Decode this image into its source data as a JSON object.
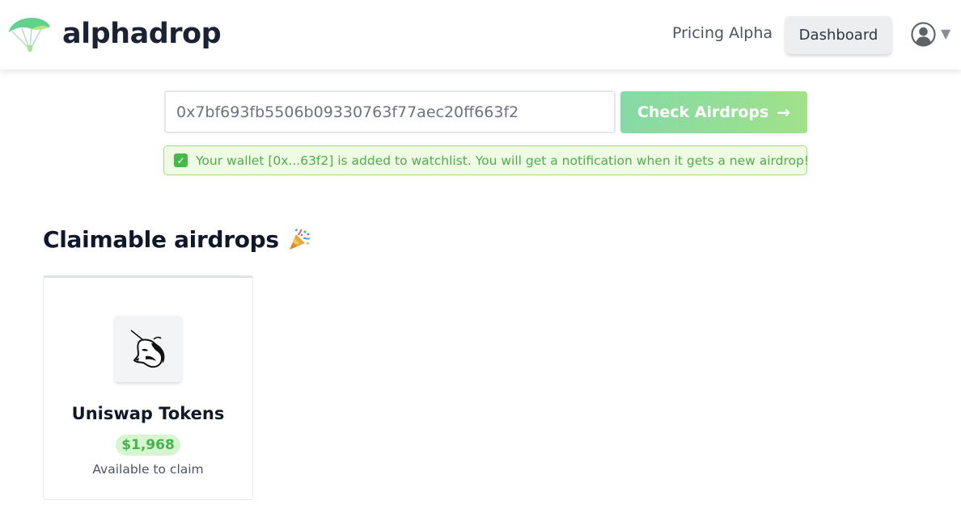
{
  "header": {
    "brand": "alphadrop",
    "nav": {
      "pricing": "Pricing",
      "alpha": "Alpha"
    },
    "dashboard_label": "Dashboard",
    "user_caret": "▼"
  },
  "search": {
    "wallet_value": "0x7bf693fb5506b09330763f77aec20ff663f2",
    "check_label": "Check Airdrops",
    "arrow": "→"
  },
  "notice": {
    "check": "✓",
    "text": "Your wallet [0x...63f2] is added to watchlist. You will get a notification when it gets a new airdrop!"
  },
  "section": {
    "title": "Claimable airdrops"
  },
  "airdrops": [
    {
      "name": "Uniswap Tokens",
      "value": "$1,968",
      "status": "Available to claim",
      "icon": "uniswap-unicorn-icon"
    }
  ],
  "colors": {
    "brand_text": "#1a2233",
    "accent_green": "#46b34c",
    "button_gradient_start": "#86d9a6",
    "button_gradient_end": "#a0e28a",
    "notice_bg": "#effbe3",
    "notice_border": "#a7d98a"
  }
}
